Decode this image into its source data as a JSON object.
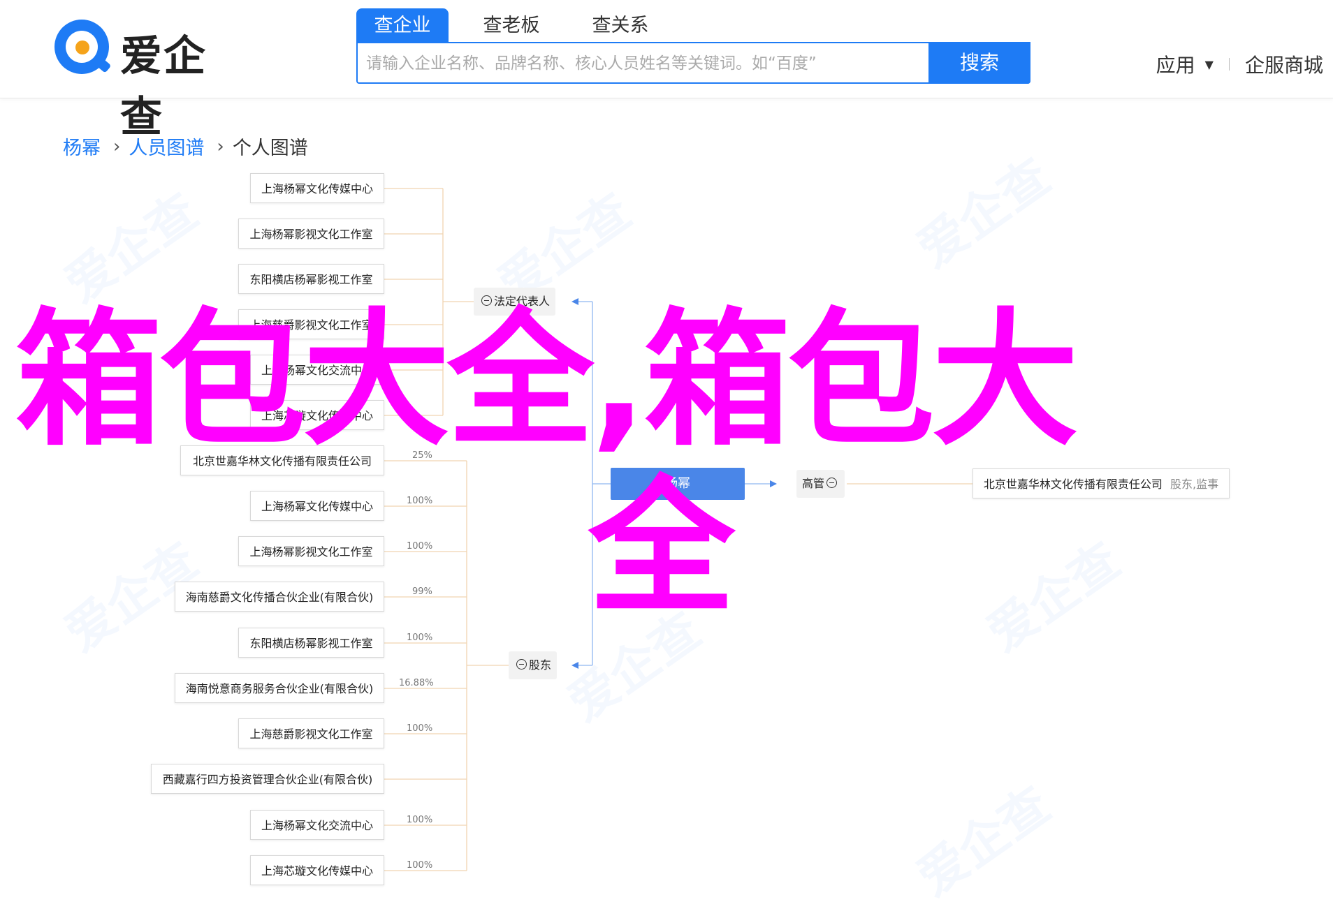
{
  "header": {
    "logo_text": "爱企查",
    "tabs": [
      {
        "label": "查企业",
        "active": true
      },
      {
        "label": "查老板",
        "active": false
      },
      {
        "label": "查关系",
        "active": false
      }
    ],
    "search": {
      "placeholder": "请输入企业名称、品牌名称、核心人员姓名等关键词。如“百度”",
      "button_label": "搜索"
    },
    "apps_label": "应用",
    "services_label": "企服商城"
  },
  "breadcrumb": {
    "items": [
      "杨幂",
      "人员图谱",
      "个人图谱"
    ]
  },
  "graph": {
    "legal_rep_label": "法定代表人",
    "shareholder_label": "股东",
    "exec_label": "高管",
    "legal_rep_nodes": [
      "上海杨幂文化传媒中心",
      "上海杨幂影视文化工作室",
      "东阳横店杨幂影视工作室",
      "上海慈爵影视文化工作室",
      "上海杨幂文化交流中心",
      "上海芯璇文化传媒中心"
    ],
    "shareholder_nodes": [
      {
        "name": "北京世嘉华林文化传播有限责任公司",
        "pct": "25%"
      },
      {
        "name": "上海杨幂文化传媒中心",
        "pct": "100%"
      },
      {
        "name": "上海杨幂影视文化工作室",
        "pct": "100%"
      },
      {
        "name": "海南慈爵文化传播合伙企业(有限合伙)",
        "pct": "99%"
      },
      {
        "name": "东阳横店杨幂影视工作室",
        "pct": "100%"
      },
      {
        "name": "海南悦意商务服务合伙企业(有限合伙)",
        "pct": "16.88%"
      },
      {
        "name": "上海慈爵影视文化工作室",
        "pct": "100%"
      },
      {
        "name": "西藏嘉行四方投资管理合伙企业(有限合伙)",
        "pct": ""
      },
      {
        "name": "上海杨幂文化交流中心",
        "pct": "100%"
      },
      {
        "name": "上海芯璇文化传媒中心",
        "pct": "100%"
      }
    ],
    "center_name": "杨幂",
    "exec_node": {
      "name": "北京世嘉华林文化传播有限责任公司",
      "role": "股东,监事"
    }
  },
  "overlay": {
    "line1": "箱包大全,箱包大",
    "line2": "全"
  },
  "colors": {
    "brand_blue": "#1e7bf5",
    "overlay_magenta": "#ff00ff",
    "center_node": "#4a86e8"
  }
}
